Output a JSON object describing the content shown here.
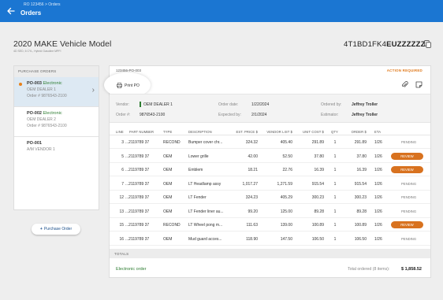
{
  "header": {
    "breadcrumb": "RO 123456 > Orders",
    "title": "Orders",
    "bg_color": "#1b76d2"
  },
  "vehicle": {
    "title": "2020 MAKE Vehicle Model",
    "subtitle": "4D SED, 6 CYL, Hybrid Gasoline MPFI",
    "vin_prefix": "4T1BD1FK4",
    "vin_suffix": "EUZZZZZZ"
  },
  "purchase_orders": {
    "header": "PURCHASE ORDERS",
    "items": [
      {
        "id": "PO-003",
        "tag": "Electronic",
        "vendor": "OEM DEALER 1",
        "order": "Order # 9876543-2100",
        "selected": true,
        "dot": true
      },
      {
        "id": "PO-002",
        "tag": "Electronic",
        "vendor": "OEM DEALER 2",
        "order": "Order # 9876543-2100",
        "selected": false,
        "dot": false
      },
      {
        "id": "PO-001",
        "tag": "",
        "vendor": "A/M VENDOR 1",
        "order": "",
        "selected": false,
        "dot": false
      }
    ],
    "add_label": "Purchase Order"
  },
  "detail": {
    "po_number": "123456-PO-003",
    "action_status": "ACTION REQUIRED",
    "print_label": "Print PO",
    "meta": {
      "vendor_label": "Vendor:",
      "vendor_value": "OEM DEALER 1",
      "order_label": "Order #:",
      "order_value": "9876543-2100",
      "order_date_label": "Order date:",
      "order_date_value": "1/22/2024",
      "expected_label": "Expected by:",
      "expected_value": "2/1/2024",
      "ordered_by_label": "Ordered by:",
      "ordered_by_value": "Jeffrey Troller",
      "estimator_label": "Estimator:",
      "estimator_value": "Jeffrey Troller"
    },
    "columns": [
      "LINE",
      "PART NUMBER",
      "TYPE",
      "DESCRIPTION",
      "EST. PRICE $",
      "VENDOR LIST $",
      "UNIT COST $",
      "QTY",
      "ORDER $",
      "ETA"
    ],
    "rows": [
      {
        "line": "3",
        "part": "...2119789 37",
        "type": "RECOND",
        "desc": "Bumper cover chr...",
        "est": "324.32",
        "list": "405.40",
        "cost": "291.89",
        "qty": "1",
        "order": "291.89",
        "eta": "1/26",
        "status": "PENDING"
      },
      {
        "line": "5",
        "part": "...2119789 37",
        "type": "OEM",
        "desc": "Lower grille",
        "est": "42.00",
        "list": "52.50",
        "cost": "37.80",
        "qty": "1",
        "order": "37.80",
        "eta": "1/26",
        "status": "REVIEW"
      },
      {
        "line": "6",
        "part": "...2119789 37",
        "type": "OEM",
        "desc": "Emblem",
        "est": "18.21",
        "list": "22.76",
        "cost": "16.39",
        "qty": "1",
        "order": "16.39",
        "eta": "1/26",
        "status": "REVIEW"
      },
      {
        "line": "7",
        "part": "...2119789 37",
        "type": "OEM",
        "desc": "LT Headlamp assy",
        "est": "1,017.27",
        "list": "1,271.59",
        "cost": "915.54",
        "qty": "1",
        "order": "915.54",
        "eta": "1/26",
        "status": "PENDING"
      },
      {
        "line": "12",
        "part": "...2119789 37",
        "type": "OEM",
        "desc": "LT Fender",
        "est": "324.23",
        "list": "405.29",
        "cost": "300.23",
        "qty": "1",
        "order": "300.23",
        "eta": "1/26",
        "status": "PENDING"
      },
      {
        "line": "13",
        "part": "...2119789 37",
        "type": "OEM",
        "desc": "LT Fender liner au...",
        "est": "99.20",
        "list": "125.00",
        "cost": "89.28",
        "qty": "1",
        "order": "89.28",
        "eta": "1/26",
        "status": "PENDING"
      },
      {
        "line": "15",
        "part": "...2119789 37",
        "type": "RECOND",
        "desc": "LT Wheel pong m...",
        "est": "111.63",
        "list": "139.00",
        "cost": "100.89",
        "qty": "1",
        "order": "100.89",
        "eta": "1/26",
        "status": "REVIEW"
      },
      {
        "line": "16",
        "part": "...2119789 37",
        "type": "OEM",
        "desc": "Mud guard acces...",
        "est": "118.90",
        "list": "147.50",
        "cost": "106.50",
        "qty": "1",
        "order": "106.50",
        "eta": "1/26",
        "status": "PENDING"
      }
    ],
    "totals_header": "TOTALS",
    "electronic_order": "Electronic order",
    "total_label": "Total ordered (8 items):",
    "total_value": "$ 1,858.52"
  },
  "colors": {
    "accent": "#1b76d2",
    "review": "#d8721f",
    "action": "#e07b1f",
    "electronic": "#2e7d32"
  }
}
